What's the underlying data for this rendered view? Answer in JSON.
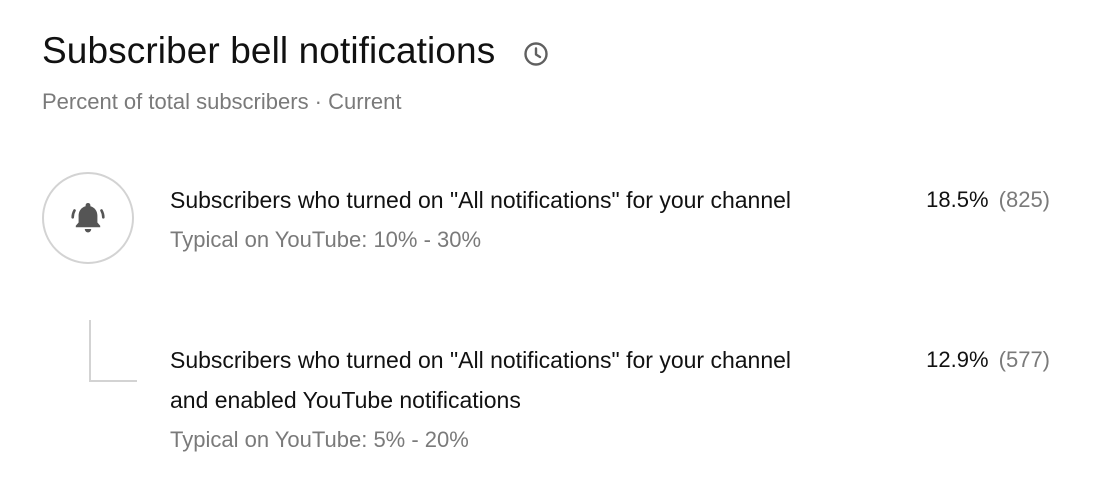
{
  "header": {
    "title": "Subscriber bell notifications",
    "subtitle": "Percent of total subscribers · Current",
    "title_icon": "clock-icon"
  },
  "metrics": [
    {
      "label": "Subscribers who turned on \"All notifications\" for your channel",
      "typical": "Typical on YouTube: 10% - 30%",
      "percent": "18.5%",
      "count": "(825)",
      "icon": "bell-ringing-icon"
    },
    {
      "label": "Subscribers who turned on \"All notifications\" for your channel and enabled YouTube notifications",
      "typical": "Typical on YouTube: 5% - 20%",
      "percent": "12.9%",
      "count": "(577)"
    }
  ],
  "colors": {
    "text_primary": "#111111",
    "text_secondary": "#7a7a7a",
    "divider": "#d3d3d3",
    "icon": "#606060"
  }
}
